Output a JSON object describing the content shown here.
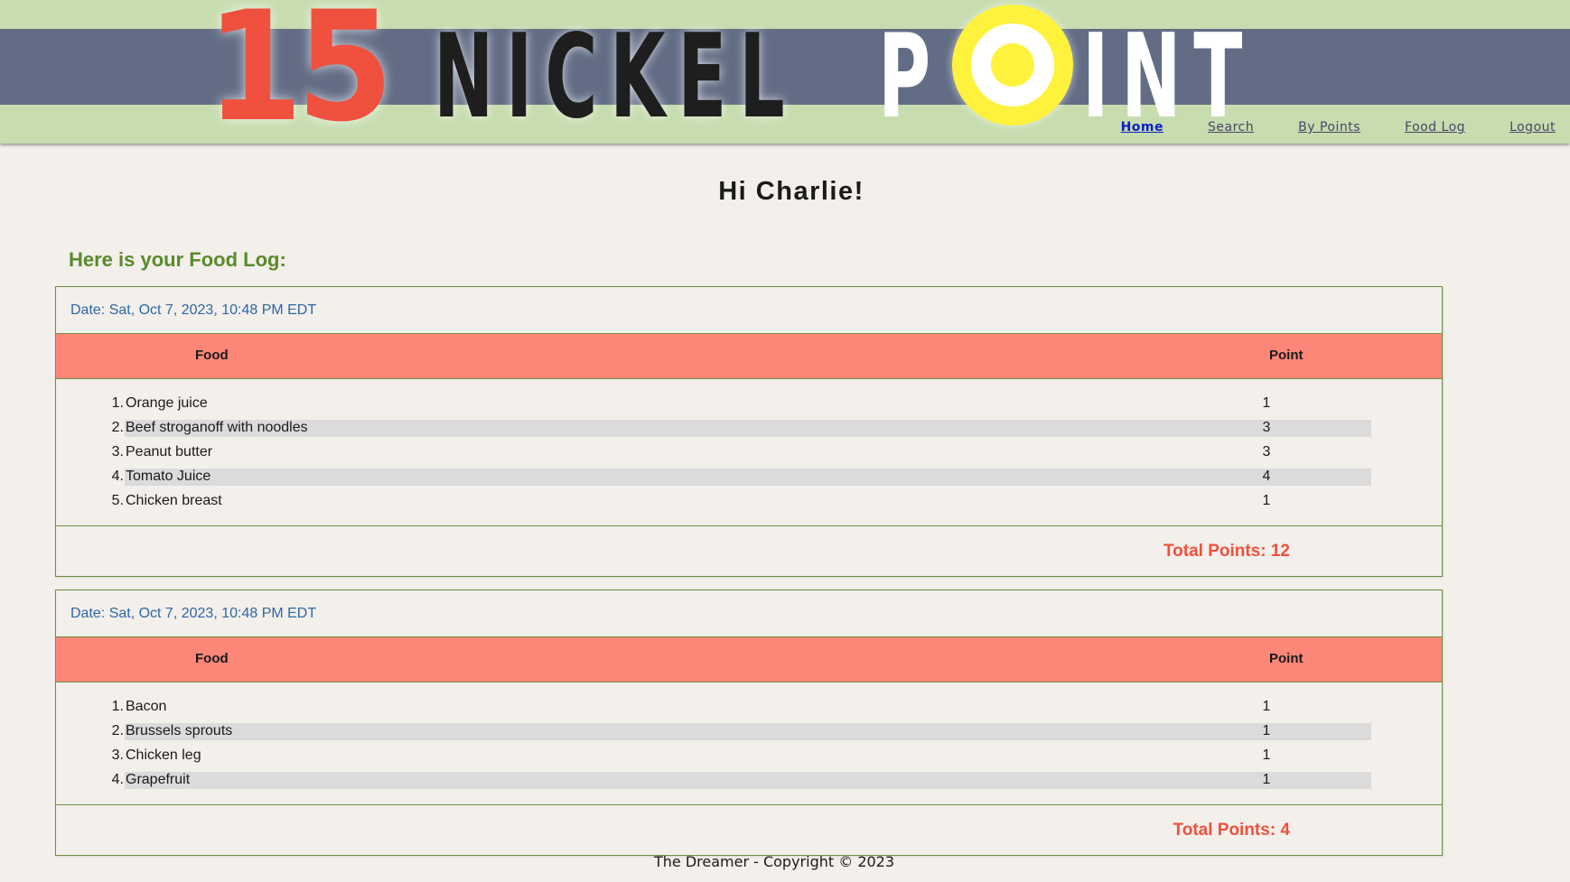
{
  "header": {
    "logo_number": "15",
    "logo_word_nickel": "NICKEL",
    "logo_word_p": "P",
    "logo_word_int": "INT",
    "nav": [
      {
        "label": "Home",
        "active": true
      },
      {
        "label": "Search",
        "active": false
      },
      {
        "label": "By Points",
        "active": false
      },
      {
        "label": "Food Log",
        "active": false
      },
      {
        "label": "Logout",
        "active": false
      }
    ]
  },
  "main": {
    "greeting": "Hi Charlie!",
    "log_heading": "Here is your Food Log:",
    "food_col_label": "Food",
    "point_col_label": "Point",
    "entries": [
      {
        "date": "Date: Sat, Oct 7, 2023, 10:48 PM EDT",
        "items": [
          {
            "num": "1.",
            "food": "Orange juice",
            "points": "1"
          },
          {
            "num": "2.",
            "food": "Beef stroganoff with noodles",
            "points": "3"
          },
          {
            "num": "3.",
            "food": "Peanut butter",
            "points": "3"
          },
          {
            "num": "4.",
            "food": "Tomato Juice",
            "points": "4"
          },
          {
            "num": "5.",
            "food": "Chicken breast",
            "points": "1"
          }
        ],
        "total": "Total Points: 12"
      },
      {
        "date": "Date: Sat, Oct 7, 2023, 10:48 PM EDT",
        "items": [
          {
            "num": "1.",
            "food": "Bacon",
            "points": "1"
          },
          {
            "num": "2.",
            "food": "Brussels sprouts",
            "points": "1"
          },
          {
            "num": "3.",
            "food": "Chicken leg",
            "points": "1"
          },
          {
            "num": "4.",
            "food": "Grapefruit",
            "points": "1"
          }
        ],
        "total": "Total Points: 4"
      }
    ]
  },
  "footer": {
    "text": "The Dreamer - Copyright © 2023"
  },
  "colors": {
    "header_bg": "#c7dcaf",
    "header_band": "#626d85",
    "logo_number": "#f0503e",
    "logo_ring": "#fff23d",
    "table_header": "#fc8678",
    "heading_green": "#5a8a2c",
    "date_blue": "#2c68a6",
    "total_red": "#f0503e",
    "nav_active": "#0b1fc4",
    "page_bg": "#f3efea"
  }
}
